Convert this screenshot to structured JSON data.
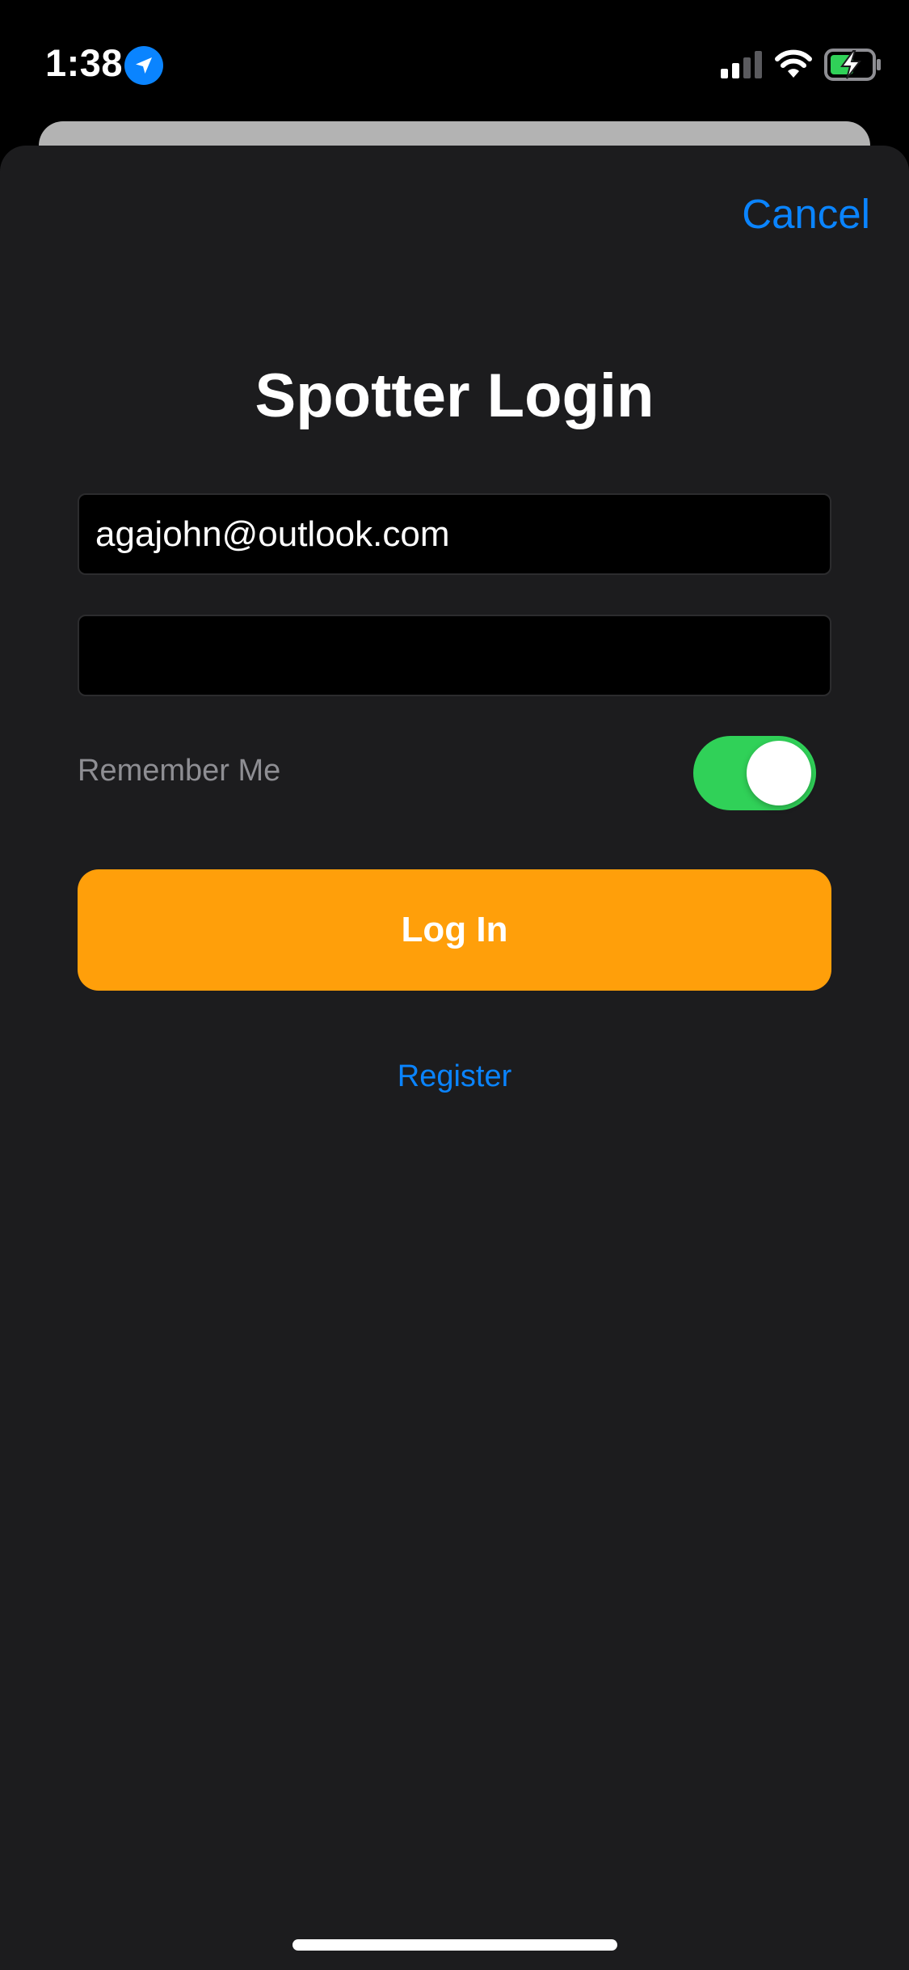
{
  "status_bar": {
    "time": "1:38",
    "icons": [
      "location-arrow-icon",
      "cellular-signal-icon",
      "wifi-icon",
      "battery-charging-icon"
    ]
  },
  "header": {
    "cancel_label": "Cancel"
  },
  "main": {
    "title": "Spotter Login",
    "email_value": "agajohn@outlook.com",
    "password_value": "",
    "remember_label": "Remember Me",
    "remember_on": true,
    "login_label": "Log In",
    "register_label": "Register"
  },
  "colors": {
    "accent_blue": "#0a84ff",
    "button_orange": "#ff9f0a",
    "toggle_green": "#30d158",
    "sheet_background": "#1c1c1e"
  }
}
